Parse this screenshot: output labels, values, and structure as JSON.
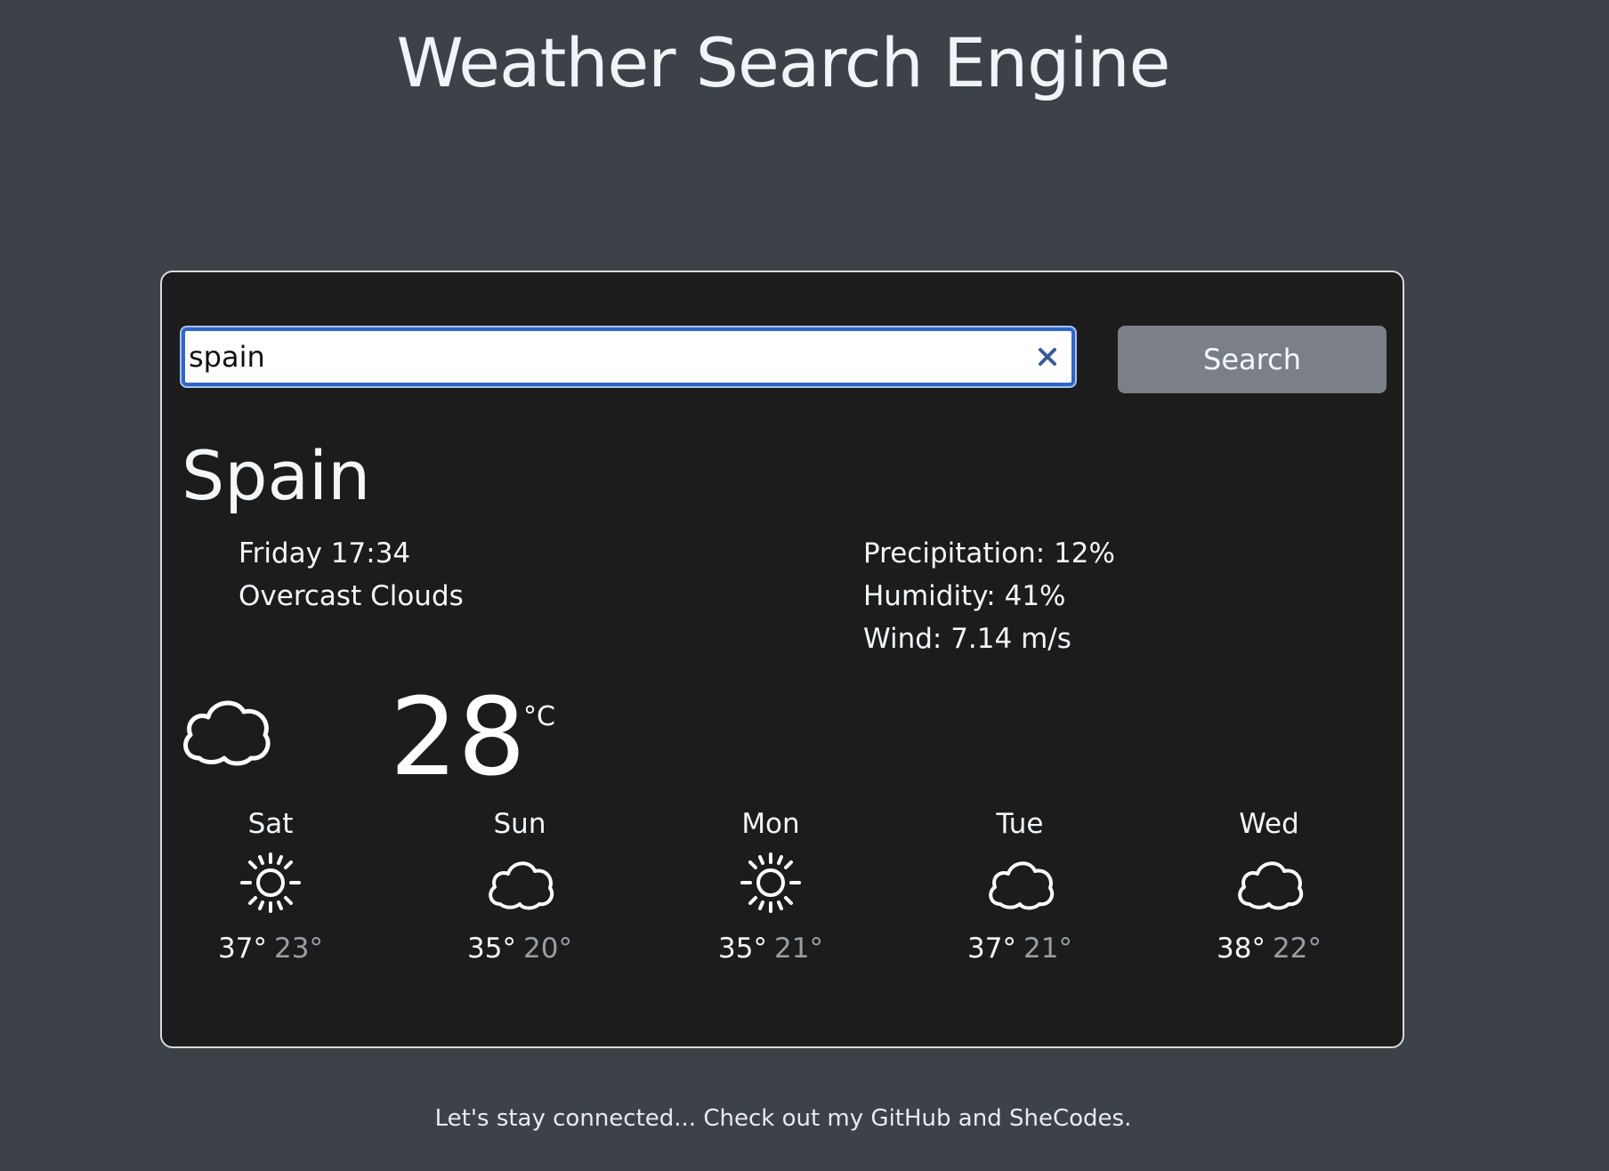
{
  "header": {
    "title": "Weather Search Engine"
  },
  "search": {
    "value": "spain",
    "button_label": "Search",
    "clear_icon": "close-icon"
  },
  "current": {
    "city": "Spain",
    "date_time": "Friday 17:34",
    "description": "Overcast Clouds",
    "precipitation": "Precipitation: 12%",
    "humidity": "Humidity: 41%",
    "wind": "Wind: 7.14 m/s",
    "temperature": "28",
    "unit": "°C",
    "icon": "cloud-icon"
  },
  "forecast": [
    {
      "day": "Sat",
      "icon": "sun-icon",
      "max": "37°",
      "min": "23°"
    },
    {
      "day": "Sun",
      "icon": "cloud-icon",
      "max": "35°",
      "min": "20°"
    },
    {
      "day": "Mon",
      "icon": "sun-icon",
      "max": "35°",
      "min": "21°"
    },
    {
      "day": "Tue",
      "icon": "cloud-icon",
      "max": "37°",
      "min": "21°"
    },
    {
      "day": "Wed",
      "icon": "cloud-icon",
      "max": "38°",
      "min": "22°"
    }
  ],
  "footer": {
    "prefix": "Let's stay connected... Check out my ",
    "github_label": "GitHub",
    "middle": " and ",
    "shecodes_label": "SheCodes",
    "suffix": "."
  },
  "colors": {
    "background": "#3d4148",
    "card": "#1c1c1d",
    "accent": "#2f66c6",
    "button": "#7b8088"
  }
}
